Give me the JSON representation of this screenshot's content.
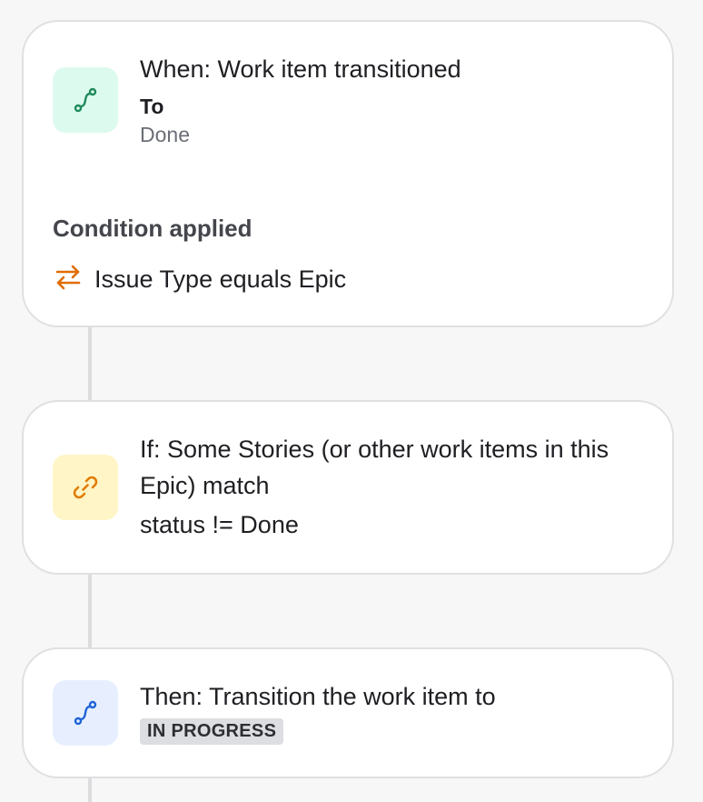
{
  "trigger": {
    "icon": "transition-path-icon",
    "title": "When: Work item transitioned",
    "to_label": "To",
    "to_value": "Done",
    "condition_heading": "Condition applied",
    "condition_icon": "swap-arrows-icon",
    "condition_text": "Issue Type equals Epic"
  },
  "if_block": {
    "icon": "link-icon",
    "title": "If: Some Stories (or other work items in this Epic) match",
    "query": "status != Done"
  },
  "then_block": {
    "icon": "transition-path-icon",
    "title": "Then: Transition the work item to",
    "status": "IN PROGRESS"
  },
  "colors": {
    "page_background": "#f7f7f7",
    "card_border": "#e0e0e3",
    "trigger_icon_bg": "#dcfbee",
    "trigger_icon": "#1f8a5b",
    "condition_icon": "#e06c00",
    "if_icon_bg": "#fff5c6",
    "if_icon": "#e07b00",
    "then_icon_bg": "#e7efff",
    "then_icon": "#1f63d6",
    "status_lozenge_bg": "#dddee1"
  }
}
